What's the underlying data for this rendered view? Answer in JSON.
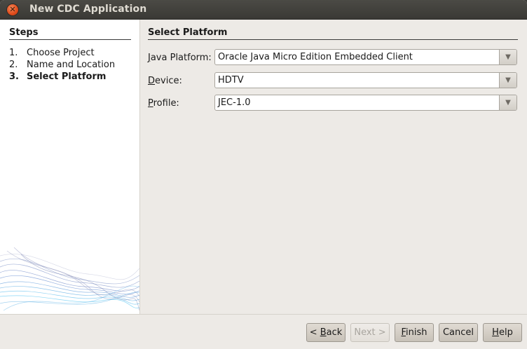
{
  "window": {
    "title": "New CDC Application"
  },
  "steps": {
    "heading": "Steps",
    "items": [
      {
        "num": "1.",
        "label": "Choose Project",
        "current": false
      },
      {
        "num": "2.",
        "label": "Name and Location",
        "current": false
      },
      {
        "num": "3.",
        "label": "Select Platform",
        "current": true
      }
    ]
  },
  "content": {
    "heading": "Select Platform",
    "fields": [
      {
        "mnemonic": "J",
        "rest": "ava Platform:",
        "value": "Oracle Java Micro Edition Embedded Client"
      },
      {
        "mnemonic": "D",
        "rest": "evice:",
        "value": "HDTV"
      },
      {
        "mnemonic": "P",
        "rest": "rofile:",
        "value": "JEC-1.0"
      }
    ]
  },
  "buttons": {
    "back": {
      "prefix": "< ",
      "mnemonic": "B",
      "rest": "ack"
    },
    "next": {
      "label": "Next >"
    },
    "finish": {
      "mnemonic": "F",
      "rest": "inish"
    },
    "cancel": {
      "label": "Cancel"
    },
    "help": {
      "mnemonic": "H",
      "rest": "elp"
    }
  },
  "icons": {
    "close": "close-icon",
    "dropdown": "chevron-down-icon"
  },
  "colors": {
    "titlebar": "#3c3b37",
    "close_button": "#df4a1a",
    "window_bg": "#edeae6",
    "steps_bg": "#ffffff"
  }
}
